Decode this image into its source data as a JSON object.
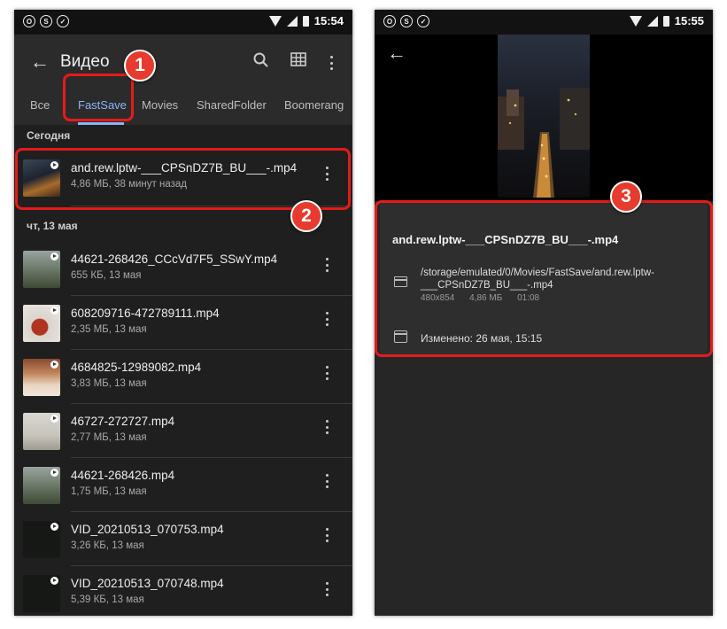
{
  "left": {
    "status_time": "15:54",
    "title": "Видео",
    "tabs": [
      {
        "label": "Все"
      },
      {
        "label": "FastSave"
      },
      {
        "label": "Movies"
      },
      {
        "label": "SharedFolder"
      },
      {
        "label": "Boomerang"
      }
    ],
    "section_today": "Сегодня",
    "section_date": "чт, 13 мая",
    "files": [
      {
        "name": "and.rew.lptw-___CPSnDZ7B_BU___-.mp4",
        "meta": "4,86 МБ, 38 минут назад"
      },
      {
        "name": "44621-268426_CCcVd7F5_SSwY.mp4",
        "meta": "655 КБ, 13 мая"
      },
      {
        "name": "608209716-472789111.mp4",
        "meta": "2,35 МБ, 13 мая"
      },
      {
        "name": "4684825-12989082.mp4",
        "meta": "3,83 МБ, 13 мая"
      },
      {
        "name": "46727-272727.mp4",
        "meta": "2,77 МБ, 13 мая"
      },
      {
        "name": "44621-268426.mp4",
        "meta": "1,75 МБ, 13 мая"
      },
      {
        "name": "VID_20210513_070753.mp4",
        "meta": "3,26 КБ, 13 мая"
      },
      {
        "name": "VID_20210513_070748.mp4",
        "meta": "5,39 КБ, 13 мая"
      }
    ]
  },
  "right": {
    "status_time": "15:55",
    "file_title": "and.rew.lptw-___CPSnDZ7B_BU___-.mp4",
    "path_line1": "/storage/emulated/0/Movies/FastSave/and.rew.lptw-",
    "path_line2": "___CPSnDZ7B_BU___-.mp4",
    "resolution": "480x854",
    "size": "4,86 МБ",
    "duration": "01:08",
    "modified": "Изменено: 26 мая, 15:15"
  },
  "badges": [
    "1",
    "2",
    "3"
  ],
  "colors": {
    "highlight": "#e51a1a",
    "badge": "#e63b2e",
    "accent": "#8ab4f8"
  }
}
